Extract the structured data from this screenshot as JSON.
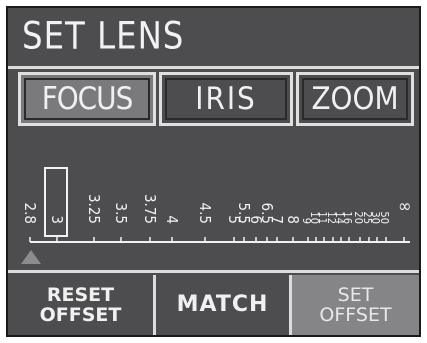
{
  "screen": {
    "title": "SET LENS"
  },
  "tabs": [
    {
      "label": "FOCUS",
      "active": true
    },
    {
      "label": "IRIS",
      "active": false
    },
    {
      "label": "ZOOM",
      "active": false
    }
  ],
  "focus_scale": {
    "labels": [
      "2.8",
      "3",
      "3.25",
      "3.5",
      "3.75",
      "4",
      "4.5",
      "5",
      "5.5",
      "6",
      "6.5",
      "7",
      "8",
      "9",
      "10",
      "11",
      "12",
      "14",
      "16",
      "20",
      "25",
      "30",
      "50",
      "∞"
    ],
    "selected_label": "3",
    "marker_icon": "triangle-up-icon",
    "colors": {
      "text": "#f2f2f2",
      "marker": "#8c8c8c"
    }
  },
  "buttons": {
    "reset_offset": "RESET\nOFFSET",
    "match": "MATCH",
    "set_offset": "SET\nOFFSET"
  },
  "colors": {
    "background": "#4d4d50",
    "active_tab": "#7a7a7c",
    "set_offset_bg": "#858587",
    "lines": "#dcdcdc"
  }
}
